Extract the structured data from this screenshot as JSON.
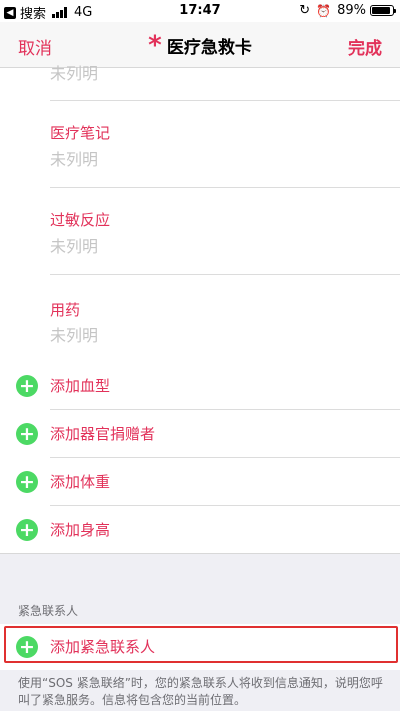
{
  "status_bar": {
    "back_app": "搜索",
    "network": "4G",
    "time": "17:47",
    "battery": "89%",
    "battery_level": 0.89
  },
  "nav": {
    "cancel": "取消",
    "star": "*",
    "title": "医疗急救卡",
    "done": "完成"
  },
  "fields": [
    {
      "label": "",
      "value": "未列明"
    },
    {
      "label": "医疗笔记",
      "value": "未列明"
    },
    {
      "label": "过敏反应",
      "value": "未列明"
    },
    {
      "label": "用药",
      "value": "未列明"
    }
  ],
  "add_items": [
    {
      "label": "添加血型"
    },
    {
      "label": "添加器官捐赠者"
    },
    {
      "label": "添加体重"
    },
    {
      "label": "添加身高"
    }
  ],
  "emergency": {
    "header": "紧急联系人",
    "add_label": "添加紧急联系人",
    "footnote": "使用“SOS 紧急联络”时，您的紧急联系人将收到信息通知，说明您呼叫了紧急服务。信息将包含您的当前位置。"
  },
  "colors": {
    "accent": "#e2325a",
    "add_green": "#4cd964",
    "placeholder": "#c5c5c5"
  }
}
